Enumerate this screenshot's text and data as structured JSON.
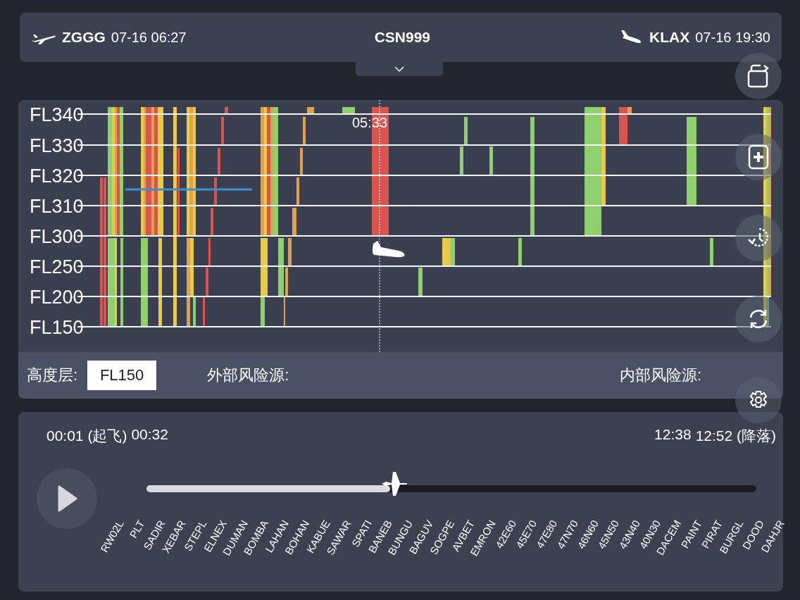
{
  "header": {
    "departure": {
      "code": "ZGGG",
      "time": "07-16 06:27"
    },
    "flight": "CSN999",
    "arrival": {
      "code": "KLAX",
      "time": "07-16 19:30"
    }
  },
  "chart": {
    "flight_levels": [
      "FL340",
      "FL330",
      "FL320",
      "FL310",
      "FL300",
      "FL250",
      "FL200",
      "FL150"
    ],
    "cursor_time": "05:33"
  },
  "info_bar": {
    "altitude_label": "高度层:",
    "altitude_value": "FL150",
    "external_label": "外部风险源:",
    "internal_label": "内部风险源:"
  },
  "player": {
    "playing": false,
    "start_time": "00:01 (起飞)",
    "current_time": "00:32",
    "end_time": "12:38",
    "landing_time": "12:52 (降落)",
    "level": 0.4,
    "waypoints": [
      "RW02L",
      "PLT",
      "SADIR",
      "XEBAR",
      "STEPL",
      "ELNEX",
      "DUMAN",
      "BOMBA",
      "LAHAN",
      "BOHAN",
      "KABUE",
      "SAWAR",
      "SPATI",
      "BANEB",
      "BUNGU",
      "BAGUV",
      "SOGPE",
      "AVBET",
      "EMRON",
      "42E60",
      "45E70",
      "47E80",
      "47N70",
      "46N60",
      "45N50",
      "43N40",
      "40N30",
      "DACEM",
      "PAINT",
      "PIRAT",
      "BURGL",
      "DOOD",
      "DAHJR"
    ]
  }
}
